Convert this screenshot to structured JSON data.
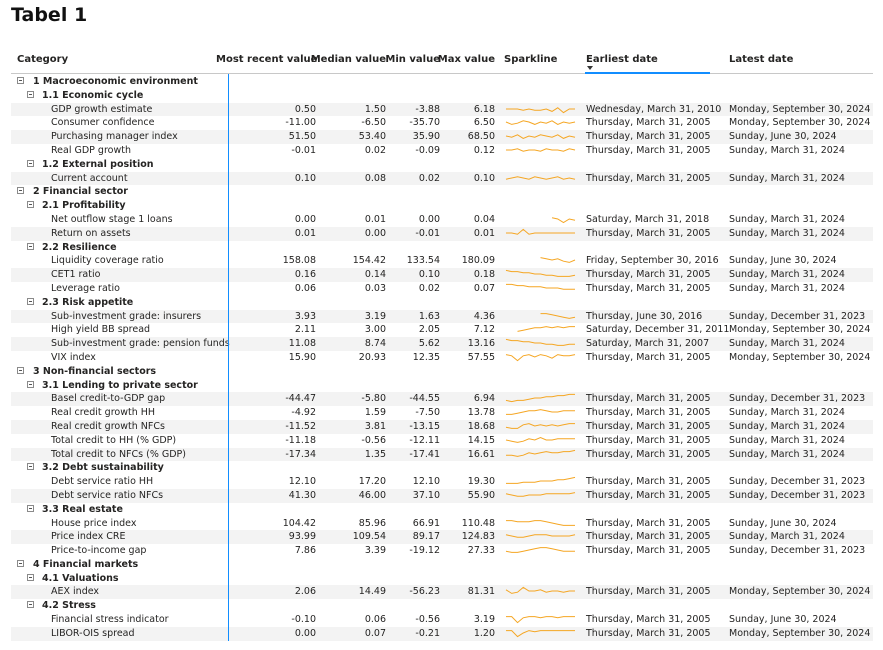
{
  "title": "Tabel 1",
  "columns": {
    "category": "Category",
    "recent": "Most recent value",
    "median": "Median value",
    "min": "Min value",
    "max": "Max value",
    "sparkline": "Sparkline",
    "earliest": "Earliest date",
    "latest": "Latest date"
  },
  "colors": {
    "accent": "#118dff",
    "sparkline": "#f5a623",
    "stripe": "#f3f3f3"
  },
  "rows": [
    {
      "type": "l1",
      "label": "1 Macroeconomic environment"
    },
    {
      "type": "l2",
      "label": "1.1 Economic cycle"
    },
    {
      "type": "data",
      "label": "GDP growth estimate",
      "recent": "0.50",
      "median": "1.50",
      "min": "-3.88",
      "max": "6.18",
      "earliest": "Wednesday, March 31, 2010",
      "latest": "Monday, September 30, 2024",
      "spark": [
        5,
        5,
        5,
        4,
        5,
        4,
        4,
        5,
        3,
        6,
        2,
        5,
        5
      ]
    },
    {
      "type": "data",
      "label": "Consumer confidence",
      "recent": "-11.00",
      "median": "-6.50",
      "min": "-35.70",
      "max": "6.50",
      "earliest": "Thursday, March 31, 2005",
      "latest": "Monday, September 30, 2024",
      "spark": [
        5,
        3,
        4,
        6,
        5,
        3,
        5,
        4,
        6,
        3,
        5,
        4,
        5
      ]
    },
    {
      "type": "data",
      "label": "Purchasing manager index",
      "recent": "51.50",
      "median": "53.40",
      "min": "35.90",
      "max": "68.50",
      "earliest": "Thursday, March 31, 2005",
      "latest": "Sunday, June 30, 2024",
      "spark": [
        5,
        4,
        6,
        3,
        5,
        4,
        6,
        5,
        4,
        6,
        3,
        5,
        4
      ]
    },
    {
      "type": "data",
      "label": "Real GDP growth",
      "recent": "-0.01",
      "median": "0.02",
      "min": "-0.09",
      "max": "0.12",
      "earliest": "Thursday, March 31, 2005",
      "latest": "Sunday, March 31, 2024",
      "spark": [
        5,
        5,
        6,
        4,
        5,
        5,
        4,
        6,
        5,
        5,
        4,
        6,
        5
      ]
    },
    {
      "type": "l2",
      "label": "1.2 External position"
    },
    {
      "type": "data",
      "label": "Current account",
      "recent": "0.10",
      "median": "0.08",
      "min": "0.02",
      "max": "0.10",
      "earliest": "Thursday, March 31, 2005",
      "latest": "Sunday, March 31, 2024",
      "spark": [
        4,
        5,
        6,
        5,
        4,
        6,
        5,
        4,
        5,
        6,
        4,
        5,
        4
      ]
    },
    {
      "type": "l1",
      "label": "2 Financial sector"
    },
    {
      "type": "l2",
      "label": "2.1 Profitability"
    },
    {
      "type": "data",
      "label": "Net outflow stage 1 loans",
      "recent": "0.00",
      "median": "0.01",
      "min": "0.00",
      "max": "0.04",
      "earliest": "Saturday, March 31, 2018",
      "latest": "Sunday, March 31, 2024",
      "spark": [
        null,
        null,
        null,
        null,
        null,
        null,
        null,
        null,
        6,
        5,
        2,
        5,
        4
      ]
    },
    {
      "type": "data",
      "label": "Return on assets",
      "recent": "0.01",
      "median": "0.00",
      "min": "-0.01",
      "max": "0.01",
      "earliest": "Thursday, March 31, 2005",
      "latest": "Sunday, March 31, 2024",
      "spark": [
        5,
        5,
        4,
        8,
        4,
        5,
        5,
        5,
        5,
        5,
        5,
        5,
        5
      ]
    },
    {
      "type": "l2",
      "label": "2.2 Resilience"
    },
    {
      "type": "data",
      "label": "Liquidity coverage ratio",
      "recent": "158.08",
      "median": "154.42",
      "min": "133.54",
      "max": "180.09",
      "earliest": "Friday, September 30, 2016",
      "latest": "Sunday, June 30, 2024",
      "spark": [
        null,
        null,
        null,
        null,
        null,
        null,
        7,
        6,
        5,
        6,
        4,
        3,
        5
      ]
    },
    {
      "type": "data",
      "label": "CET1 ratio",
      "recent": "0.16",
      "median": "0.14",
      "min": "0.10",
      "max": "0.18",
      "earliest": "Thursday, March 31, 2005",
      "latest": "Sunday, March 31, 2024",
      "spark": [
        8,
        7,
        7,
        6,
        6,
        5,
        5,
        4,
        4,
        3,
        3,
        3,
        4
      ]
    },
    {
      "type": "data",
      "label": "Leverage ratio",
      "recent": "0.06",
      "median": "0.03",
      "min": "0.02",
      "max": "0.07",
      "earliest": "Thursday, March 31, 2005",
      "latest": "Sunday, March 31, 2024",
      "spark": [
        8,
        8,
        7,
        7,
        6,
        6,
        6,
        5,
        5,
        5,
        4,
        4,
        4
      ]
    },
    {
      "type": "l2",
      "label": "2.3 Risk appetite"
    },
    {
      "type": "data",
      "label": "Sub-investment grade: insurers",
      "recent": "3.93",
      "median": "3.19",
      "min": "1.63",
      "max": "4.36",
      "earliest": "Thursday, June 30, 2016",
      "latest": "Sunday, December 31, 2023",
      "spark": [
        null,
        null,
        null,
        null,
        null,
        null,
        7,
        7,
        6,
        5,
        4,
        3,
        4
      ]
    },
    {
      "type": "data",
      "label": "High yield BB spread",
      "recent": "2.11",
      "median": "3.00",
      "min": "2.05",
      "max": "7.12",
      "earliest": "Saturday, December 31, 2011",
      "latest": "Monday, September 30, 2024",
      "spark": [
        null,
        null,
        3,
        4,
        5,
        6,
        6,
        7,
        6,
        7,
        6,
        7,
        7
      ]
    },
    {
      "type": "data",
      "label": "Sub-investment grade: pension funds",
      "recent": "11.08",
      "median": "8.74",
      "min": "5.62",
      "max": "13.16",
      "earliest": "Saturday, March 31, 2007",
      "latest": "Sunday, March 31, 2024",
      "spark": [
        8,
        7,
        7,
        6,
        6,
        5,
        5,
        4,
        4,
        3,
        3,
        4,
        4
      ]
    },
    {
      "type": "data",
      "label": "VIX index",
      "recent": "15.90",
      "median": "20.93",
      "min": "12.35",
      "max": "57.55",
      "earliest": "Thursday, March 31, 2005",
      "latest": "Monday, September 30, 2024",
      "spark": [
        7,
        6,
        2,
        6,
        7,
        5,
        7,
        6,
        4,
        7,
        6,
        6,
        7
      ]
    },
    {
      "type": "l1",
      "label": "3 Non-financial sectors"
    },
    {
      "type": "l2",
      "label": "3.1 Lending to private sector"
    },
    {
      "type": "data",
      "label": "Basel credit-to-GDP gap",
      "recent": "-44.47",
      "median": "-5.80",
      "min": "-44.55",
      "max": "6.94",
      "earliest": "Thursday, March 31, 2005",
      "latest": "Sunday, December 31, 2023",
      "spark": [
        3,
        2,
        3,
        3,
        4,
        5,
        5,
        6,
        6,
        7,
        7,
        8,
        8
      ]
    },
    {
      "type": "data",
      "label": "Real credit growth HH",
      "recent": "-4.92",
      "median": "1.59",
      "min": "-7.50",
      "max": "13.78",
      "earliest": "Thursday, March 31, 2005",
      "latest": "Sunday, March 31, 2024",
      "spark": [
        3,
        3,
        4,
        5,
        6,
        6,
        7,
        6,
        5,
        5,
        6,
        6,
        6
      ]
    },
    {
      "type": "data",
      "label": "Real credit growth NFCs",
      "recent": "-11.52",
      "median": "3.81",
      "min": "-13.15",
      "max": "18.68",
      "earliest": "Thursday, March 31, 2005",
      "latest": "Sunday, March 31, 2024",
      "spark": [
        4,
        3,
        3,
        6,
        7,
        5,
        6,
        5,
        6,
        5,
        6,
        7,
        7
      ]
    },
    {
      "type": "data",
      "label": "Total credit to HH (% GDP)",
      "recent": "-11.18",
      "median": "-0.56",
      "min": "-12.11",
      "max": "14.15",
      "earliest": "Thursday, March 31, 2005",
      "latest": "Sunday, March 31, 2024",
      "spark": [
        5,
        4,
        3,
        4,
        6,
        5,
        7,
        5,
        5,
        6,
        6,
        6,
        6
      ]
    },
    {
      "type": "data",
      "label": "Total credit to NFCs (% GDP)",
      "recent": "-17.34",
      "median": "1.35",
      "min": "-17.41",
      "max": "16.61",
      "earliest": "Thursday, March 31, 2005",
      "latest": "Sunday, March 31, 2024",
      "spark": [
        4,
        4,
        3,
        4,
        6,
        5,
        6,
        7,
        6,
        6,
        7,
        7,
        8
      ]
    },
    {
      "type": "l2",
      "label": "3.2 Debt sustainability"
    },
    {
      "type": "data",
      "label": "Debt service ratio HH",
      "recent": "12.10",
      "median": "17.20",
      "min": "12.10",
      "max": "19.30",
      "earliest": "Thursday, March 31, 2005",
      "latest": "Sunday, December 31, 2023",
      "spark": [
        3,
        3,
        3,
        4,
        4,
        4,
        5,
        5,
        5,
        6,
        6,
        7,
        8
      ]
    },
    {
      "type": "data",
      "label": "Debt service ratio NFCs",
      "recent": "41.30",
      "median": "46.00",
      "min": "37.10",
      "max": "55.90",
      "earliest": "Thursday, March 31, 2005",
      "latest": "Sunday, December 31, 2023",
      "spark": [
        6,
        5,
        4,
        4,
        5,
        5,
        5,
        6,
        6,
        6,
        6,
        6,
        7
      ]
    },
    {
      "type": "l2",
      "label": "3.3 Real estate"
    },
    {
      "type": "data",
      "label": "House price index",
      "recent": "104.42",
      "median": "85.96",
      "min": "66.91",
      "max": "110.48",
      "earliest": "Thursday, March 31, 2005",
      "latest": "Sunday, June 30, 2024",
      "spark": [
        7,
        7,
        6,
        6,
        6,
        7,
        7,
        6,
        5,
        4,
        3,
        3,
        3
      ]
    },
    {
      "type": "data",
      "label": "Price index CRE",
      "recent": "93.99",
      "median": "109.54",
      "min": "89.17",
      "max": "124.83",
      "earliest": "Thursday, March 31, 2005",
      "latest": "Sunday, March 31, 2024",
      "spark": [
        6,
        5,
        4,
        4,
        5,
        6,
        6,
        6,
        5,
        5,
        5,
        5,
        6
      ]
    },
    {
      "type": "data",
      "label": "Price-to-income gap",
      "recent": "7.86",
      "median": "3.39",
      "min": "-19.12",
      "max": "27.33",
      "earliest": "Thursday, March 31, 2005",
      "latest": "Sunday, December 31, 2023",
      "spark": [
        4,
        3,
        3,
        4,
        5,
        6,
        7,
        7,
        6,
        5,
        4,
        4,
        4
      ]
    },
    {
      "type": "l1",
      "label": "4 Financial markets"
    },
    {
      "type": "l2",
      "label": "4.1 Valuations"
    },
    {
      "type": "data",
      "label": "AEX index",
      "recent": "2.06",
      "median": "14.49",
      "min": "-56.23",
      "max": "81.31",
      "earliest": "Thursday, March 31, 2005",
      "latest": "Monday, September 30, 2024",
      "spark": [
        6,
        3,
        4,
        8,
        5,
        5,
        6,
        4,
        5,
        5,
        4,
        5,
        5
      ]
    },
    {
      "type": "l2",
      "label": "4.2 Stress"
    },
    {
      "type": "data",
      "label": "Financial stress indicator",
      "recent": "-0.10",
      "median": "0.06",
      "min": "-0.56",
      "max": "3.19",
      "earliest": "Thursday, March 31, 2005",
      "latest": "Sunday, June 30, 2024",
      "spark": [
        7,
        7,
        2,
        6,
        7,
        7,
        6,
        7,
        7,
        6,
        7,
        7,
        7
      ]
    },
    {
      "type": "data",
      "label": "LIBOR-OIS spread",
      "recent": "0.00",
      "median": "0.07",
      "min": "-0.21",
      "max": "1.20",
      "earliest": "Thursday, March 31, 2005",
      "latest": "Monday, September 30, 2024",
      "spark": [
        7,
        7,
        2,
        5,
        7,
        6,
        7,
        7,
        7,
        7,
        7,
        7,
        7
      ]
    }
  ]
}
